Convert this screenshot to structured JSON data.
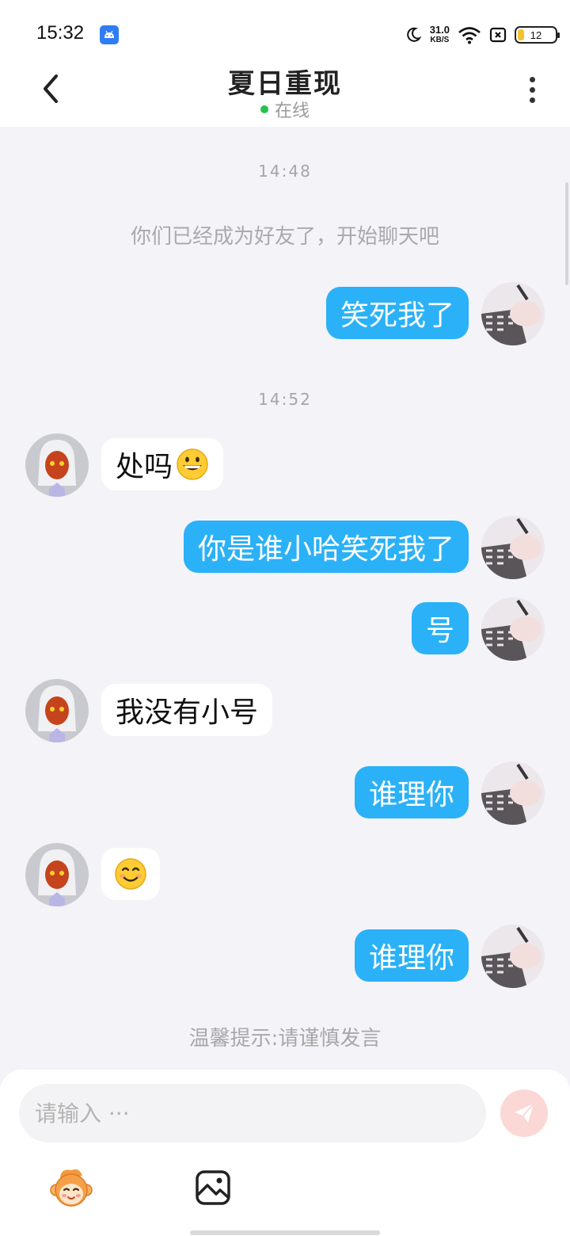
{
  "status_bar": {
    "time": "15:32",
    "net_speed": "31.0",
    "net_unit": "KB/S",
    "battery": "12"
  },
  "header": {
    "title": "夏日重现",
    "status": "在线"
  },
  "chat": {
    "time_1": "14:48",
    "system_notice": "你们已经成为好友了，开始聊天吧",
    "time_2": "14:52",
    "messages": [
      {
        "dir": "out",
        "text": "笑死我了"
      },
      {
        "dir": "in",
        "text": "处吗"
      },
      {
        "dir": "out",
        "text": "你是谁小哈笑死我了"
      },
      {
        "dir": "out",
        "text": "号"
      },
      {
        "dir": "in",
        "text": "我没有小号"
      },
      {
        "dir": "out",
        "text": "谁理你"
      },
      {
        "dir": "in",
        "text": ""
      },
      {
        "dir": "out",
        "text": "谁理你"
      }
    ],
    "tip": "温馨提示:请谨慎发言"
  },
  "input": {
    "placeholder": "请输入 ···"
  },
  "colors": {
    "accent": "#2bb1f7",
    "background": "#f4f3f8",
    "online": "#22c24a",
    "send_disabled": "#fbd8d5"
  }
}
